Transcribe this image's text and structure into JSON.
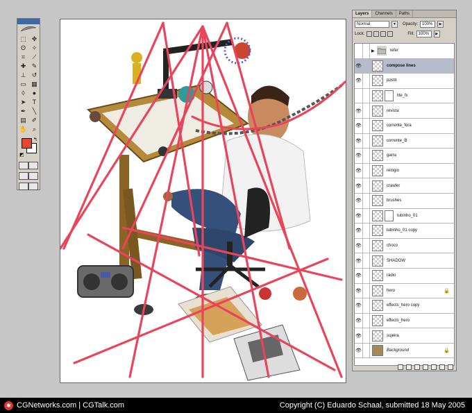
{
  "tools": {
    "items": [
      {
        "name": "marquee-tool-icon",
        "glyph": "⬚"
      },
      {
        "name": "move-tool-icon",
        "glyph": "✥"
      },
      {
        "name": "lasso-tool-icon",
        "glyph": "ʘ"
      },
      {
        "name": "magic-wand-tool-icon",
        "glyph": "✧"
      },
      {
        "name": "crop-tool-icon",
        "glyph": "⌗"
      },
      {
        "name": "slice-tool-icon",
        "glyph": "⟋"
      },
      {
        "name": "healing-brush-tool-icon",
        "glyph": "✚"
      },
      {
        "name": "brush-tool-icon",
        "glyph": "✎"
      },
      {
        "name": "clone-stamp-tool-icon",
        "glyph": "⊥"
      },
      {
        "name": "history-brush-tool-icon",
        "glyph": "↺"
      },
      {
        "name": "eraser-tool-icon",
        "glyph": "▭"
      },
      {
        "name": "gradient-tool-icon",
        "glyph": "▦"
      },
      {
        "name": "blur-tool-icon",
        "glyph": "◊"
      },
      {
        "name": "dodge-tool-icon",
        "glyph": "●"
      },
      {
        "name": "path-selection-tool-icon",
        "glyph": "➤"
      },
      {
        "name": "type-tool-icon",
        "glyph": "T"
      },
      {
        "name": "pen-tool-icon",
        "glyph": "✒"
      },
      {
        "name": "line-tool-icon",
        "glyph": "╲"
      },
      {
        "name": "notes-tool-icon",
        "glyph": "▤"
      },
      {
        "name": "eyedropper-tool-icon",
        "glyph": "✐"
      },
      {
        "name": "hand-tool-icon",
        "glyph": "✋"
      },
      {
        "name": "zoom-tool-icon",
        "glyph": "⌕"
      }
    ],
    "foreground_color": "#e8462e",
    "background_color": "#ffffff"
  },
  "layers_panel": {
    "tabs": [
      "Layers",
      "Channels",
      "Paths"
    ],
    "blend_mode": "Normal",
    "opacity_label": "Opacity:",
    "opacity_value": "100%",
    "lock_label": "Lock:",
    "fill_label": "Fill:",
    "fill_value": "100%",
    "layers": [
      {
        "name": "refer",
        "type": "group",
        "visible": false
      },
      {
        "name": "compose lines",
        "type": "layer",
        "visible": true,
        "selected": true
      },
      {
        "name": "postit",
        "type": "layer",
        "visible": true
      },
      {
        "name": "lite_fx",
        "type": "masked",
        "visible": false
      },
      {
        "name": "revista",
        "type": "layer",
        "visible": true
      },
      {
        "name": "corrente_fora",
        "type": "layer",
        "visible": true
      },
      {
        "name": "corrente_B",
        "type": "layer",
        "visible": true
      },
      {
        "name": "garra",
        "type": "layer",
        "visible": true
      },
      {
        "name": "relogio",
        "type": "layer",
        "visible": true
      },
      {
        "name": "crawler",
        "type": "layer",
        "visible": true
      },
      {
        "name": "brushes",
        "type": "layer",
        "visible": true
      },
      {
        "name": "tubinho_01",
        "type": "masked",
        "visible": true
      },
      {
        "name": "tubinho_01 copy",
        "type": "layer",
        "visible": true
      },
      {
        "name": "choco",
        "type": "layer",
        "visible": true
      },
      {
        "name": "SHADOW",
        "type": "layer",
        "visible": true
      },
      {
        "name": "radio",
        "type": "layer",
        "visible": true
      },
      {
        "name": "hero",
        "type": "layer",
        "visible": true,
        "locked": true
      },
      {
        "name": "effects_hero copy",
        "type": "layer",
        "visible": true
      },
      {
        "name": "effects_hero",
        "type": "layer",
        "visible": true
      },
      {
        "name": "sujeira",
        "type": "layer",
        "visible": true
      },
      {
        "name": "Background",
        "type": "background",
        "visible": true,
        "locked": true
      }
    ]
  },
  "footer": {
    "site": "CGNetworks.com | CGTalk.com",
    "copyright": "Copyright (C) Eduardo Schaal, submitted 18 May 2005"
  }
}
